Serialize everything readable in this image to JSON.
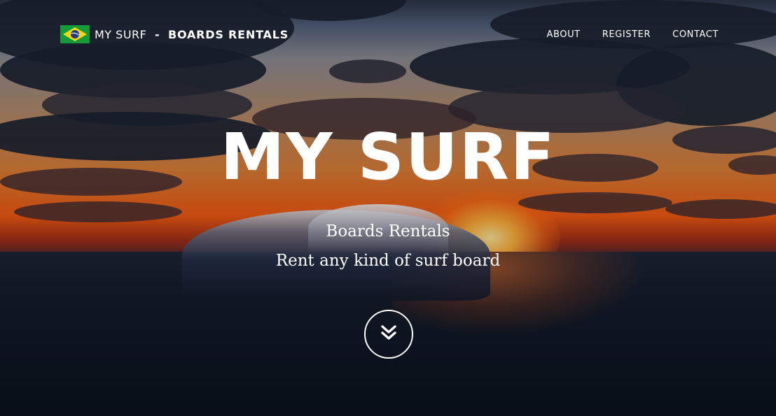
{
  "nav": {
    "brand_name": "MY SURF",
    "brand_separator": "-",
    "brand_tagline": "BOARDS RENTALS",
    "links": [
      {
        "label": "ABOUT"
      },
      {
        "label": "REGISTER"
      },
      {
        "label": "CONTACT"
      }
    ]
  },
  "hero": {
    "title": "MY SURF",
    "subtitle_line1": "Boards Rentals",
    "subtitle_line2": "Rent any kind of surf board"
  },
  "icons": {
    "brand_logo": "brazil-flag-icon",
    "scroll_down": "double-chevron-down-icon"
  },
  "colors": {
    "text": "#ffffff",
    "flag_green": "#169b3a",
    "flag_yellow": "#f7d616",
    "flag_blue": "#1f3b8f"
  }
}
